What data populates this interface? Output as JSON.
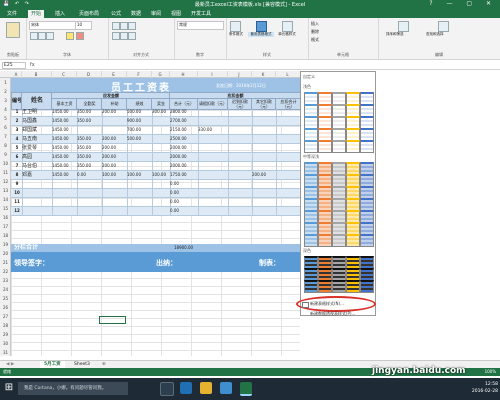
{
  "window": {
    "title": "最新员工excel工资表模板.xls [兼容模式] - Excel",
    "quick_access": "💾 ↶ ↷",
    "window_controls": "? — ▢ ✕"
  },
  "ribbon": {
    "tabs": [
      "文件",
      "开始",
      "插入",
      "页面布局",
      "公式",
      "数据",
      "审阅",
      "视图",
      "开发工具"
    ],
    "active_tab": "开始",
    "font_name": "宋体",
    "font_size": "10",
    "number_format": "常规",
    "groups": [
      "剪贴板",
      "字体",
      "对齐方式",
      "数字",
      "样式",
      "单元格",
      "编辑"
    ],
    "buttons": {
      "conditional": "条件格式",
      "table_format": "套用表格格式",
      "cell_styles": "单元格样式",
      "insert": "插入",
      "delete": "删除",
      "format": "格式",
      "sort": "排序和筛选",
      "find": "查找和选择"
    }
  },
  "formula_bar": {
    "name_box": "E25",
    "fx": "fx"
  },
  "columns": [
    "A",
    "B",
    "C",
    "D",
    "E",
    "F",
    "G",
    "H",
    "I",
    "J",
    "K",
    "L"
  ],
  "rows": [
    "1",
    "2",
    "3",
    "4",
    "5",
    "6",
    "7",
    "8",
    "9",
    "10",
    "11",
    "12",
    "13",
    "14",
    "15",
    "16",
    "17",
    "18",
    "19",
    "20",
    "21",
    "22",
    "23",
    "24",
    "25",
    "26",
    "27",
    "28",
    "29",
    "30",
    "31"
  ],
  "table": {
    "title": "员工工资表",
    "date_label": "发放日期：2016年2月12日",
    "group_headers": {
      "base": "应发金额",
      "deduct": "应扣金额"
    },
    "headers": [
      "编号",
      "姓名",
      "基本工资",
      "全勤奖",
      "补助",
      "绩效",
      "奖金",
      "合计（元）",
      "请假扣款（元）",
      "迟到扣款（元）",
      "其它扣款（元）",
      "应扣合计（元）"
    ],
    "rows": [
      [
        "1",
        "王卫明",
        "1450.00",
        "350.00",
        "200.00",
        "500.00",
        "300.00",
        "2800.00",
        "",
        "",
        "",
        ""
      ],
      [
        "2",
        "马国鑫",
        "1450.00",
        "350.00",
        "",
        "900.00",
        "",
        "2700.00",
        "",
        "",
        "",
        ""
      ],
      [
        "3",
        "郑国斌",
        "1450.00",
        "",
        "",
        "700.00",
        "",
        "2150.00",
        "330.00",
        "",
        "",
        ""
      ],
      [
        "4",
        "马五南",
        "1450.00",
        "350.00",
        "200.00",
        "500.00",
        "",
        "2500.00",
        "",
        "",
        "",
        ""
      ],
      [
        "5",
        "张爱琴",
        "1450.00",
        "350.00",
        "200.00",
        "",
        "",
        "2000.00",
        "",
        "",
        "",
        ""
      ],
      [
        "6",
        "高园",
        "1450.00",
        "350.00",
        "200.00",
        "",
        "",
        "2000.00",
        "",
        "",
        "",
        ""
      ],
      [
        "7",
        "马台伯",
        "1450.00",
        "350.00",
        "200.00",
        "",
        "",
        "2000.00",
        "",
        "",
        "",
        ""
      ],
      [
        "8",
        "邓嘉",
        "1450.00",
        "0.00",
        "100.00",
        "100.00",
        "100.00",
        "1750.00",
        "",
        "",
        "200.00",
        ""
      ],
      [
        "9",
        "",
        "",
        "",
        "",
        "",
        "",
        "0.00",
        "",
        "",
        "",
        ""
      ],
      [
        "10",
        "",
        "",
        "",
        "",
        "",
        "",
        "0.00",
        "",
        "",
        "",
        ""
      ],
      [
        "11",
        "",
        "",
        "",
        "",
        "",
        "",
        "0.00",
        "",
        "",
        "",
        ""
      ],
      [
        "12",
        "",
        "",
        "",
        "",
        "",
        "",
        "0.00",
        "",
        "",
        "",
        ""
      ]
    ],
    "total_label": "分栏合计",
    "total_value": "18900.00",
    "sign_labels": {
      "leader": "领导签字：",
      "cashier": "出纳：",
      "maker": "制表："
    }
  },
  "gallery": {
    "title": "自定义",
    "sections": [
      "浅色",
      "中等深浅",
      "深色"
    ],
    "new_style": "新建表格样式(N)...",
    "new_pivot": "新建数据透视表样式(P)...",
    "palette": [
      "#ffffff",
      "#5b9bd5",
      "#ed7d31",
      "#a5a5a5",
      "#ffc000",
      "#4472c4",
      "#70ad47"
    ]
  },
  "sheet_tabs": [
    "5月工资",
    "Sheet3"
  ],
  "sheet_tab_add": "⊕",
  "status": {
    "ready": "就绪",
    "zoom": "100%"
  },
  "taskbar": {
    "search": "我是 Cortana，小娜。有问题尽管问我。",
    "time": "12:58",
    "date": "2016-02-28"
  },
  "watermark": "jingyan.baidu.com"
}
